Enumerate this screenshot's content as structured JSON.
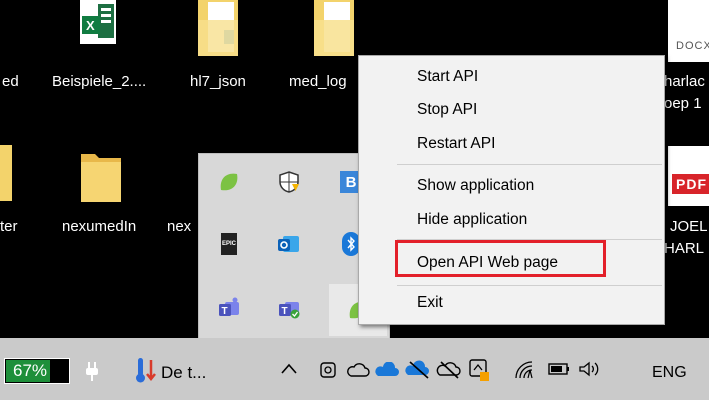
{
  "desktop": {
    "icons": [
      {
        "label": "ed"
      },
      {
        "label": "Beispiele_2...."
      },
      {
        "label": "hl7_json"
      },
      {
        "label": "med_log"
      },
      {
        "label": "ter"
      },
      {
        "label": "nexumedIn"
      },
      {
        "label": "nex"
      }
    ],
    "right_labels": {
      "docx_badge": "DOCX",
      "line1": "harlac",
      "line2": "oep 1",
      "pdf_badge": "PDF",
      "line3": "JOEL",
      "line4": "HARL"
    }
  },
  "tray_overflow": {
    "icons": [
      {
        "name": "green-app-icon"
      },
      {
        "name": "windows-security-icon"
      },
      {
        "name": "blue-b-app-icon"
      },
      {
        "name": "epic-games-icon",
        "text": "EPIC"
      },
      {
        "name": "outlook-icon"
      },
      {
        "name": "bluetooth-icon"
      },
      {
        "name": "teams-icon"
      },
      {
        "name": "teams-check-icon"
      },
      {
        "name": "green-app-icon-selected"
      }
    ]
  },
  "context_menu": {
    "items": [
      {
        "label": "Start API"
      },
      {
        "label": "Stop API"
      },
      {
        "label": "Restart API"
      },
      {
        "label": "Show application"
      },
      {
        "label": "Hide application"
      },
      {
        "label": "Open API Web page"
      },
      {
        "label": "Exit"
      }
    ],
    "highlight_color": "#e3202a"
  },
  "taskbar": {
    "battery_percent_text": "67%",
    "weather_text": "De t...",
    "language": "ENG",
    "battery_color": "#1e8f3a"
  }
}
